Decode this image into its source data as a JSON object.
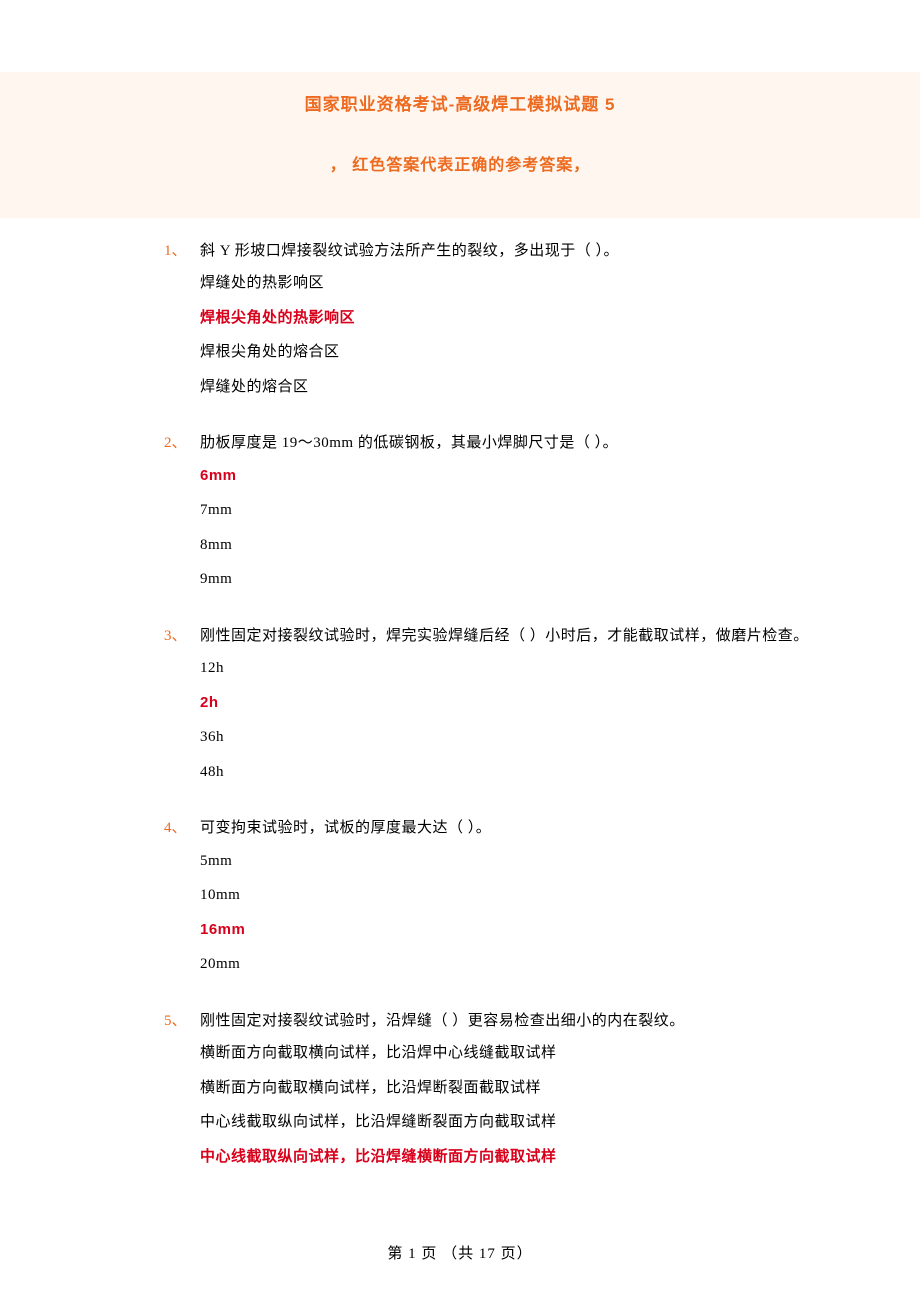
{
  "header": {
    "title": "国家职业资格考试-高级焊工模拟试题 5",
    "subtitle": "，  红色答案代表正确的参考答案，"
  },
  "questions": [
    {
      "num": "1、",
      "text": "斜 Y 形坡口焊接裂纹试验方法所产生的裂纹，多出现于（ ）。",
      "options": [
        {
          "label": "焊缝处的热影响区",
          "correct": false
        },
        {
          "label": "焊根尖角处的热影响区",
          "correct": true
        },
        {
          "label": "焊根尖角处的熔合区",
          "correct": false
        },
        {
          "label": "焊缝处的熔合区",
          "correct": false
        }
      ]
    },
    {
      "num": "2、",
      "text": "肋板厚度是 19～30mm 的低碳钢板，其最小焊脚尺寸是（ ）。",
      "options": [
        {
          "label": "6mm",
          "correct": true
        },
        {
          "label": "7mm",
          "correct": false
        },
        {
          "label": "8mm",
          "correct": false
        },
        {
          "label": "9mm",
          "correct": false
        }
      ]
    },
    {
      "num": "3、",
      "text": "刚性固定对接裂纹试验时，焊完实验焊缝后经（ ）小时后，才能截取试样，做磨片检查。",
      "options": [
        {
          "label": "12h",
          "correct": false
        },
        {
          "label": "2h",
          "correct": true
        },
        {
          "label": "36h",
          "correct": false
        },
        {
          "label": "48h",
          "correct": false
        }
      ]
    },
    {
      "num": "4、",
      "text": "可变拘束试验时，试板的厚度最大达（ ）。",
      "options": [
        {
          "label": "5mm",
          "correct": false
        },
        {
          "label": "10mm",
          "correct": false
        },
        {
          "label": "16mm",
          "correct": true
        },
        {
          "label": "20mm",
          "correct": false
        }
      ]
    },
    {
      "num": "5、",
      "text": "刚性固定对接裂纹试验时，沿焊缝（ ）更容易检查出细小的内在裂纹。",
      "options": [
        {
          "label": "横断面方向截取横向试样，比沿焊中心线缝截取试样",
          "correct": false
        },
        {
          "label": "横断面方向截取横向试样，比沿焊断裂面截取试样",
          "correct": false
        },
        {
          "label": "中心线截取纵向试样，比沿焊缝断裂面方向截取试样",
          "correct": false
        },
        {
          "label": "中心线截取纵向试样，比沿焊缝横断面方向截取试样",
          "correct": true
        }
      ]
    }
  ],
  "footer": "第 1 页  （共 17 页）"
}
